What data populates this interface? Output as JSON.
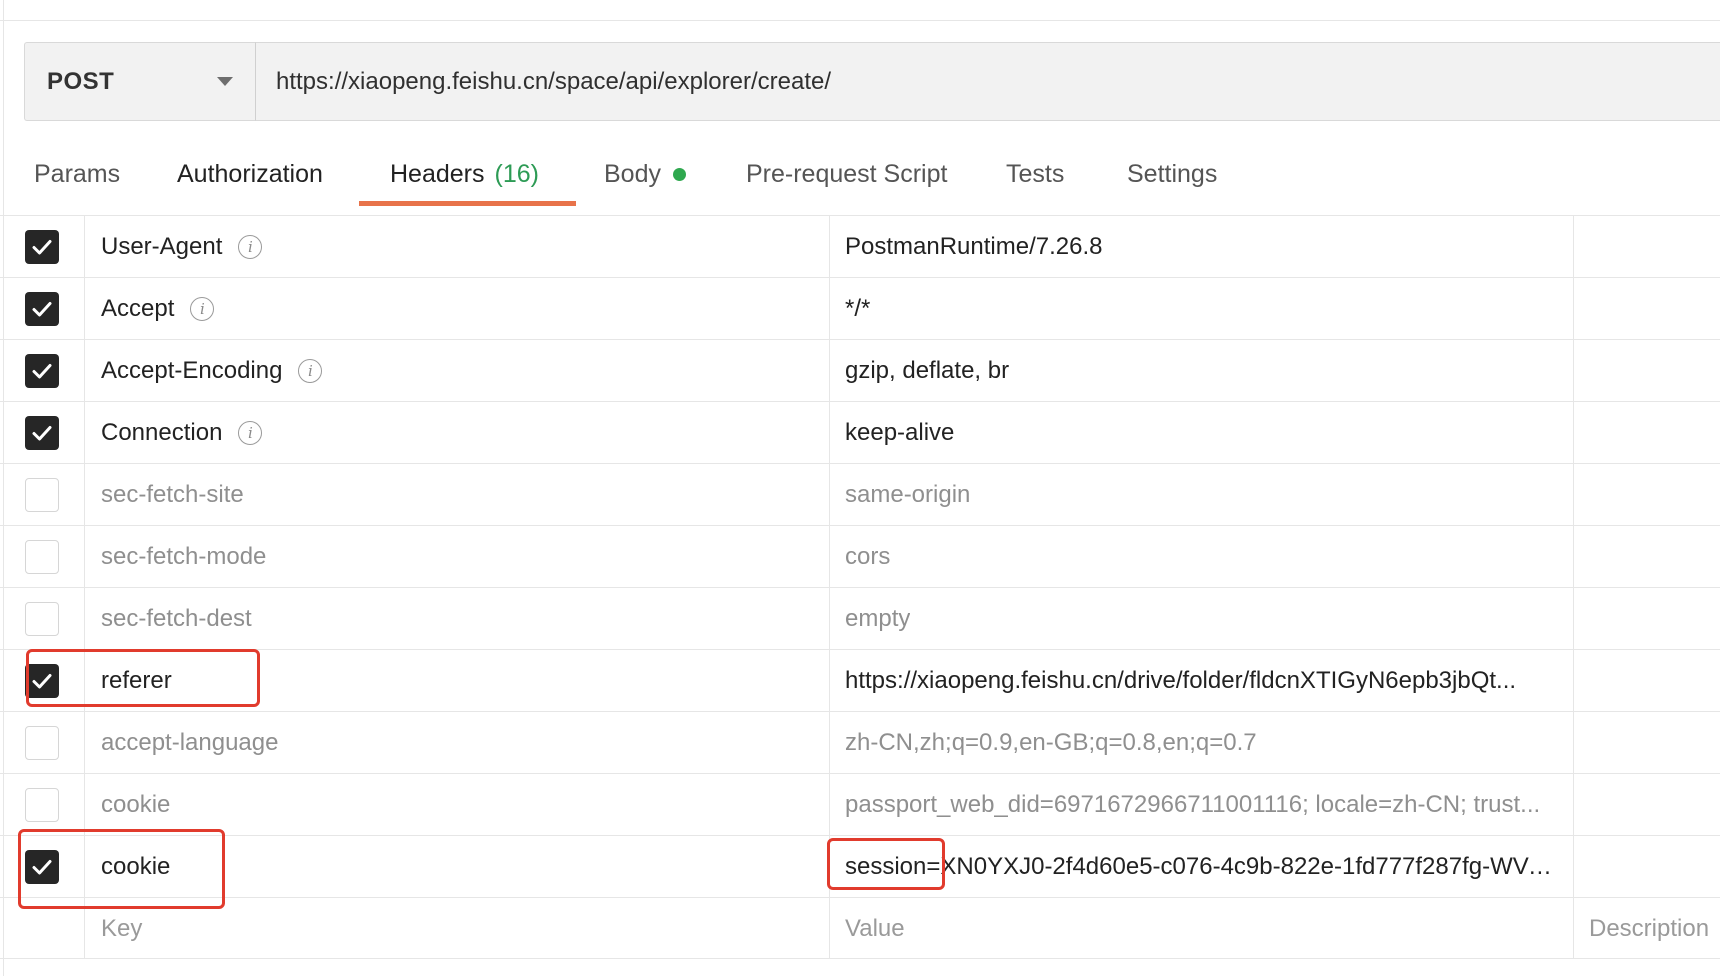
{
  "request": {
    "method": "POST",
    "url": "https://xiaopeng.feishu.cn/space/api/explorer/create/"
  },
  "tabs": [
    {
      "label": "Params"
    },
    {
      "label": "Authorization"
    },
    {
      "label": "Headers",
      "count": "(16)"
    },
    {
      "label": "Body"
    },
    {
      "label": "Pre-request Script"
    },
    {
      "label": "Tests"
    },
    {
      "label": "Settings"
    }
  ],
  "colors": {
    "active_tab_underline": "#e8734a",
    "header_count": "#2d9b55",
    "body_dot": "#2fa84f",
    "annotation_red": "#e13b2d"
  },
  "headers": [
    {
      "key": "User-Agent",
      "value": "PostmanRuntime/7.26.8",
      "checked": true,
      "info": true
    },
    {
      "key": "Accept",
      "value": "*/*",
      "checked": true,
      "info": true
    },
    {
      "key": "Accept-Encoding",
      "value": "gzip, deflate, br",
      "checked": true,
      "info": true
    },
    {
      "key": "Connection",
      "value": "keep-alive",
      "checked": true,
      "info": true
    },
    {
      "key": "sec-fetch-site",
      "value": "same-origin",
      "checked": false
    },
    {
      "key": "sec-fetch-mode",
      "value": "cors",
      "checked": false
    },
    {
      "key": "sec-fetch-dest",
      "value": "empty",
      "checked": false
    },
    {
      "key": "referer",
      "value": "https://xiaopeng.feishu.cn/drive/folder/fldcnXTIGyN6epb3jbQt...",
      "checked": true
    },
    {
      "key": "accept-language",
      "value": "zh-CN,zh;q=0.9,en-GB;q=0.8,en;q=0.7",
      "checked": false
    },
    {
      "key": "cookie",
      "value": "passport_web_did=6971672966711001116; locale=zh-CN; trust...",
      "checked": false
    },
    {
      "key": "cookie",
      "value": "session=XN0YXJ0-2f4d60e5-c076-4c9b-822e-1fd777f287fg-WVu...",
      "checked": true
    }
  ],
  "new_row": {
    "key_placeholder": "Key",
    "value_placeholder": "Value",
    "description_placeholder": "Description"
  },
  "info_glyph": "i"
}
